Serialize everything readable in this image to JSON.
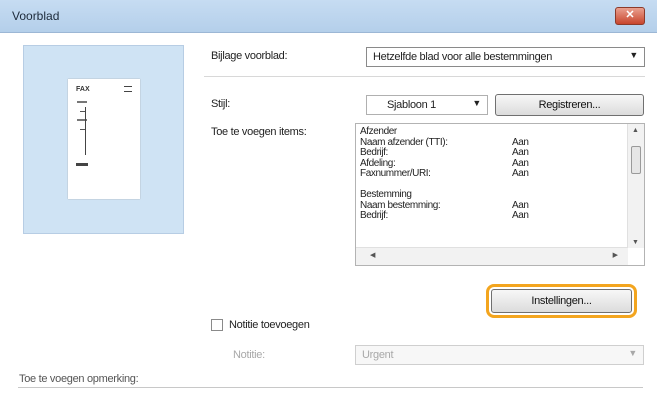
{
  "window": {
    "title": "Voorblad",
    "close_label": "✕"
  },
  "preview": {
    "page_label": "FAX"
  },
  "attach_cover": {
    "label": "Bijlage voorblad:",
    "value": "Hetzelfde blad voor alle bestemmingen"
  },
  "style": {
    "label": "Stijl:",
    "value": "Sjabloon 1",
    "register_button": "Registreren..."
  },
  "items": {
    "label": "Toe te voegen items:",
    "rows": [
      {
        "key": "Afzender",
        "val": ""
      },
      {
        "key": "Naam afzender (TTI):",
        "val": "Aan"
      },
      {
        "key": "Bedrijf:",
        "val": "Aan"
      },
      {
        "key": "Afdeling:",
        "val": "Aan"
      },
      {
        "key": "Faxnummer/URI:",
        "val": "Aan"
      },
      {
        "key": "",
        "val": ""
      },
      {
        "key": "Bestemming",
        "val": ""
      },
      {
        "key": "Naam bestemming:",
        "val": "Aan"
      },
      {
        "key": "Bedrijf:",
        "val": "Aan"
      }
    ],
    "settings_button": "Instellingen..."
  },
  "note": {
    "checkbox_label": "Notitie toevoegen",
    "field_label": "Notitie:",
    "value": "Urgent"
  },
  "remark": {
    "label": "Toe te voegen opmerking:"
  }
}
